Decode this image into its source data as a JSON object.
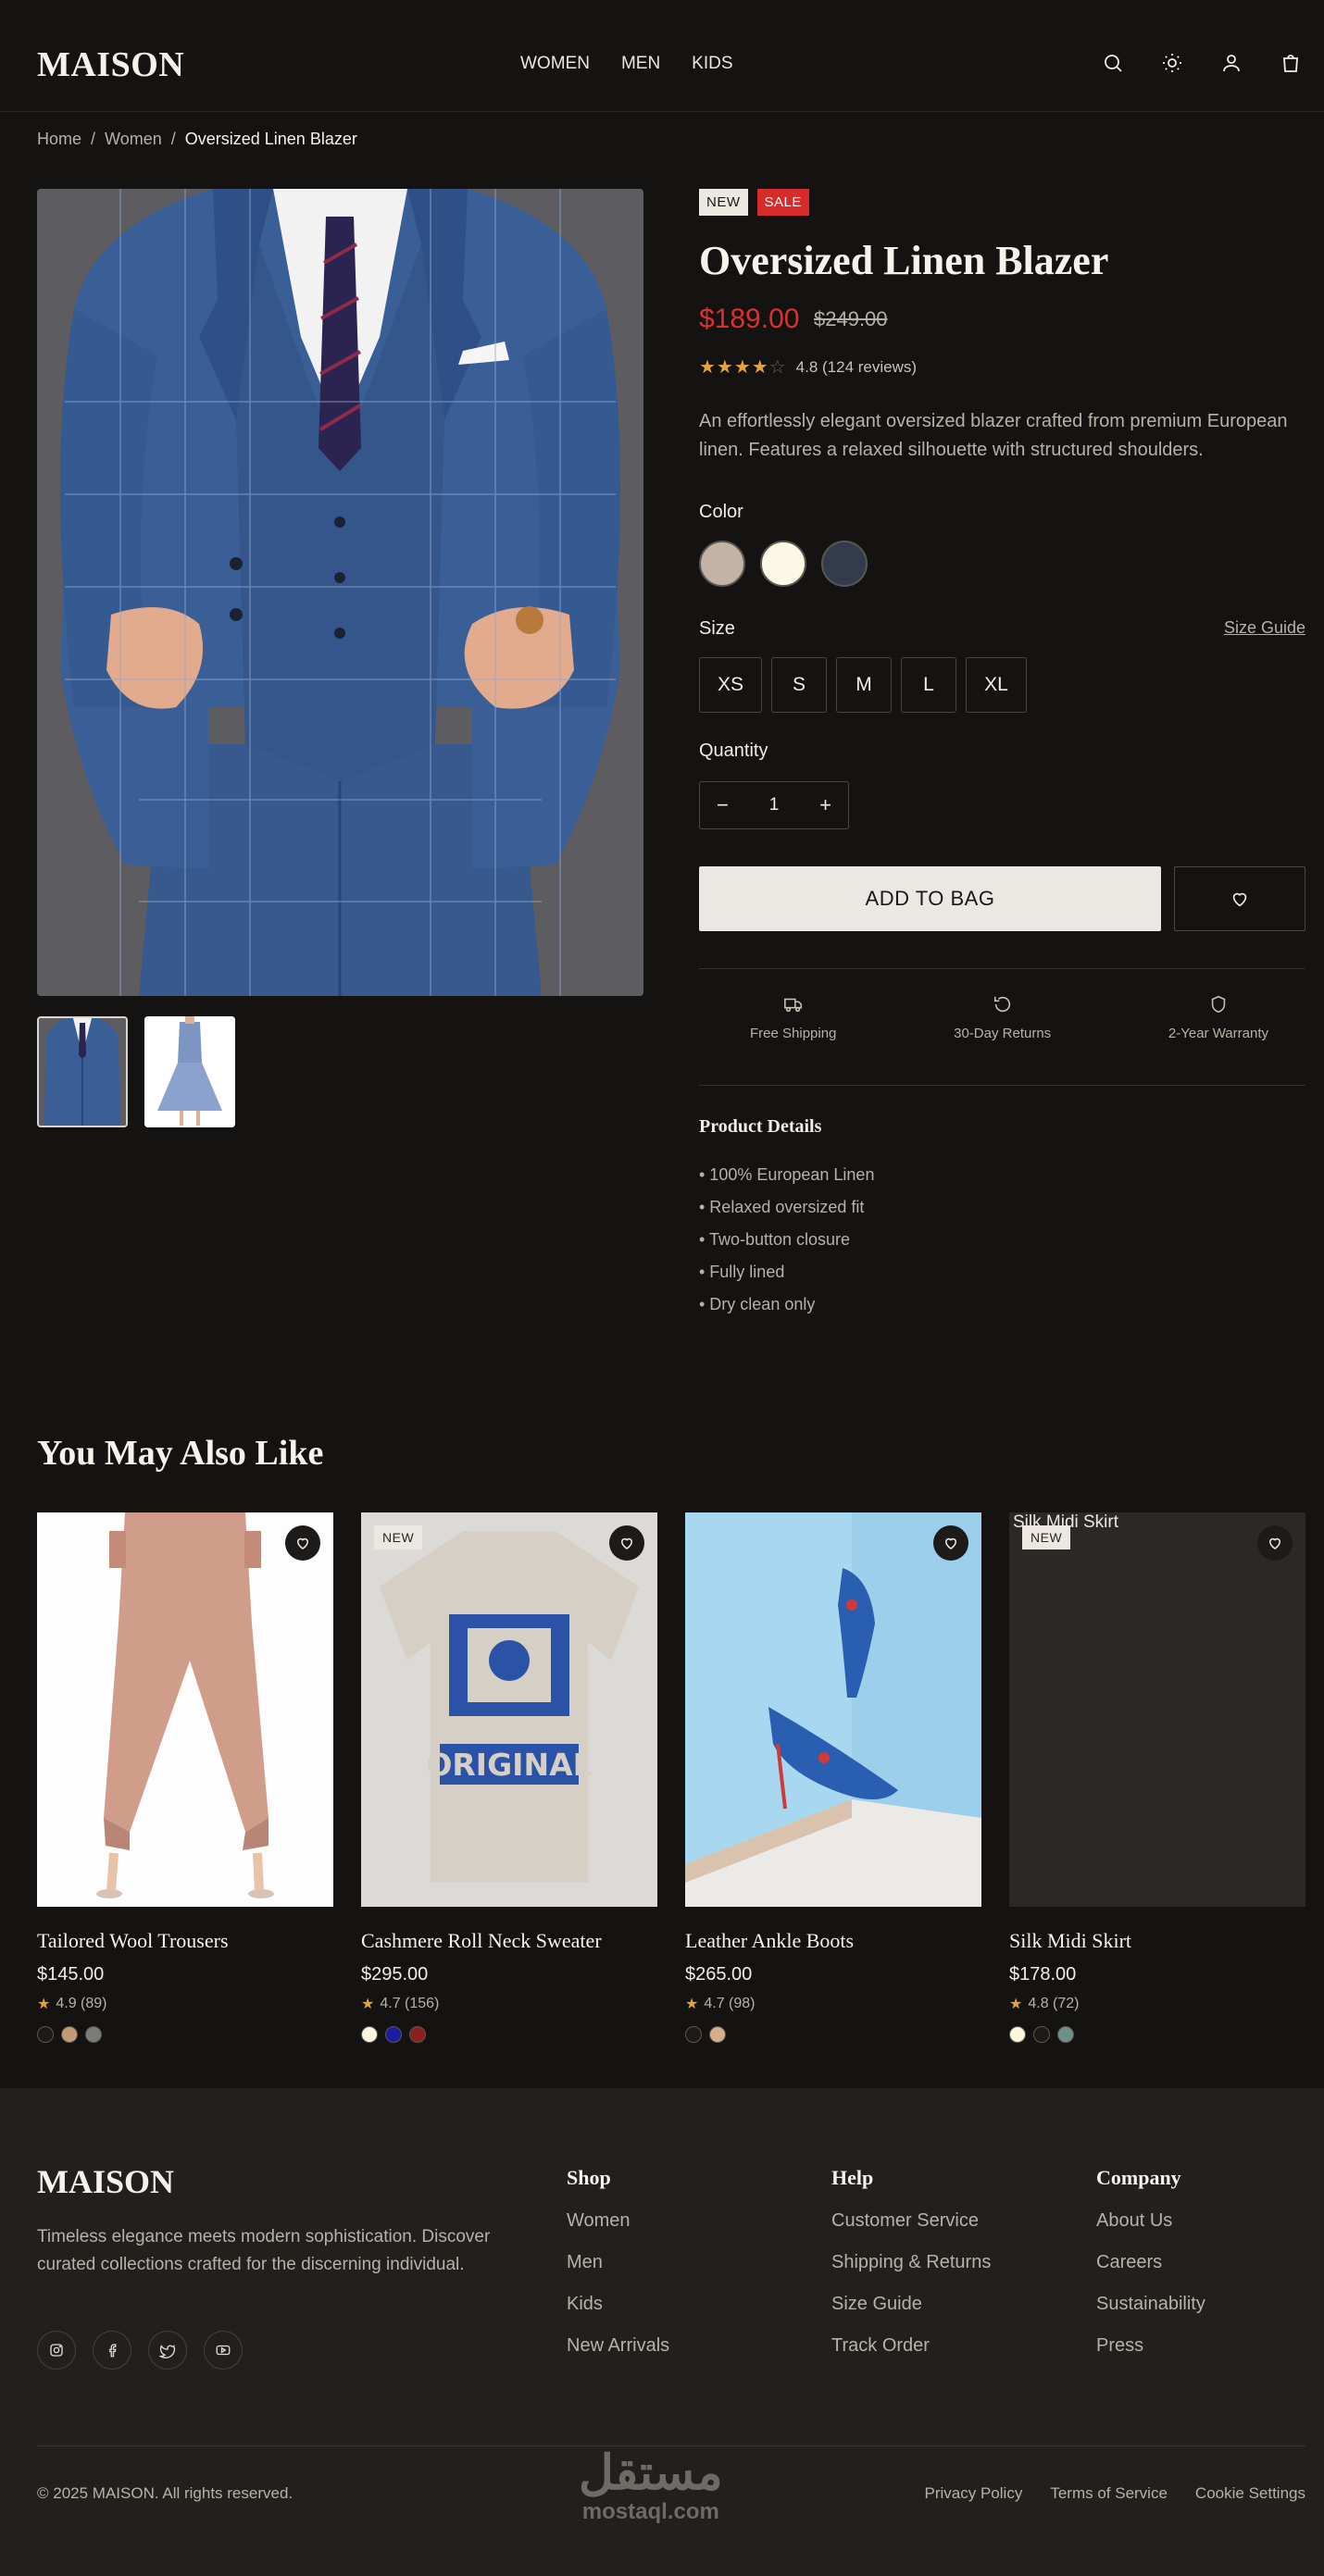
{
  "brand": "MAISON",
  "nav": [
    "WOMEN",
    "MEN",
    "KIDS"
  ],
  "header_icons": [
    "search-icon",
    "sun-icon",
    "user-icon",
    "bag-icon"
  ],
  "breadcrumb": {
    "home": "Home",
    "sep": "/",
    "section": "Women",
    "current": "Oversized Linen Blazer"
  },
  "product": {
    "badge_new": "NEW",
    "badge_sale": "SALE",
    "title": "Oversized Linen Blazer",
    "price": "$189.00",
    "old_price": "$249.00",
    "rating_value": 4.8,
    "rating_text": "4.8 (124 reviews)",
    "description": "An effortlessly elegant oversized blazer crafted from premium European linen. Features a relaxed silhouette with structured shoulders.",
    "color_label": "Color",
    "colors": [
      "#c3b3a4",
      "#fbf8e6",
      "#333c4c"
    ],
    "size_label": "Size",
    "size_guide": "Size Guide",
    "sizes": [
      "XS",
      "S",
      "M",
      "L",
      "XL"
    ],
    "quantity_label": "Quantity",
    "quantity": "1",
    "minus": "−",
    "plus": "+",
    "add_to_bag": "ADD TO BAG",
    "features": [
      "Free Shipping",
      "30-Day Returns",
      "2-Year Warranty"
    ],
    "details_heading": "Product Details",
    "details": [
      "• 100% European Linen",
      "• Relaxed oversized fit",
      "• Two-button closure",
      "• Fully lined",
      "• Dry clean only"
    ]
  },
  "related": {
    "heading": "You May Also Like",
    "items": [
      {
        "name": "Tailored Wool Trousers",
        "price": "$145.00",
        "rating": "4.9 (89)",
        "new": "",
        "alt": "",
        "colors": [
          "#1c1a18",
          "#c49a74",
          "#7b7b79"
        ]
      },
      {
        "name": "Cashmere Roll Neck Sweater",
        "price": "$295.00",
        "rating": "4.7 (156)",
        "new": "NEW",
        "alt": "",
        "colors": [
          "#fbf6dc",
          "#1c1ca0",
          "#8c1f1f"
        ]
      },
      {
        "name": "Leather Ankle Boots",
        "price": "$265.00",
        "rating": "4.7 (98)",
        "new": "",
        "alt": "",
        "colors": [
          "#1c1a18",
          "#d4b08a"
        ]
      },
      {
        "name": "Silk Midi Skirt",
        "price": "$178.00",
        "rating": "4.8 (72)",
        "new": "NEW",
        "alt": "Silk Midi Skirt",
        "colors": [
          "#fbf6dc",
          "#1c1a18",
          "#6f9088"
        ]
      }
    ],
    "star": "★"
  },
  "footer": {
    "brand": "MAISON",
    "tagline": "Timeless elegance meets modern sophistication. Discover curated collections crafted for the discerning individual.",
    "social": [
      "instagram-icon",
      "facebook-icon",
      "twitter-icon",
      "youtube-icon"
    ],
    "columns": [
      {
        "title": "Shop",
        "links": [
          "Women",
          "Men",
          "Kids",
          "New Arrivals"
        ]
      },
      {
        "title": "Help",
        "links": [
          "Customer Service",
          "Shipping & Returns",
          "Size Guide",
          "Track Order"
        ]
      },
      {
        "title": "Company",
        "links": [
          "About Us",
          "Careers",
          "Sustainability",
          "Press"
        ]
      }
    ],
    "copyright": "© 2025 MAISON. All rights reserved.",
    "legal": [
      "Privacy Policy",
      "Terms of Service",
      "Cookie Settings"
    ],
    "watermark_ar": "مستقل",
    "watermark_en": "mostaql.com"
  }
}
